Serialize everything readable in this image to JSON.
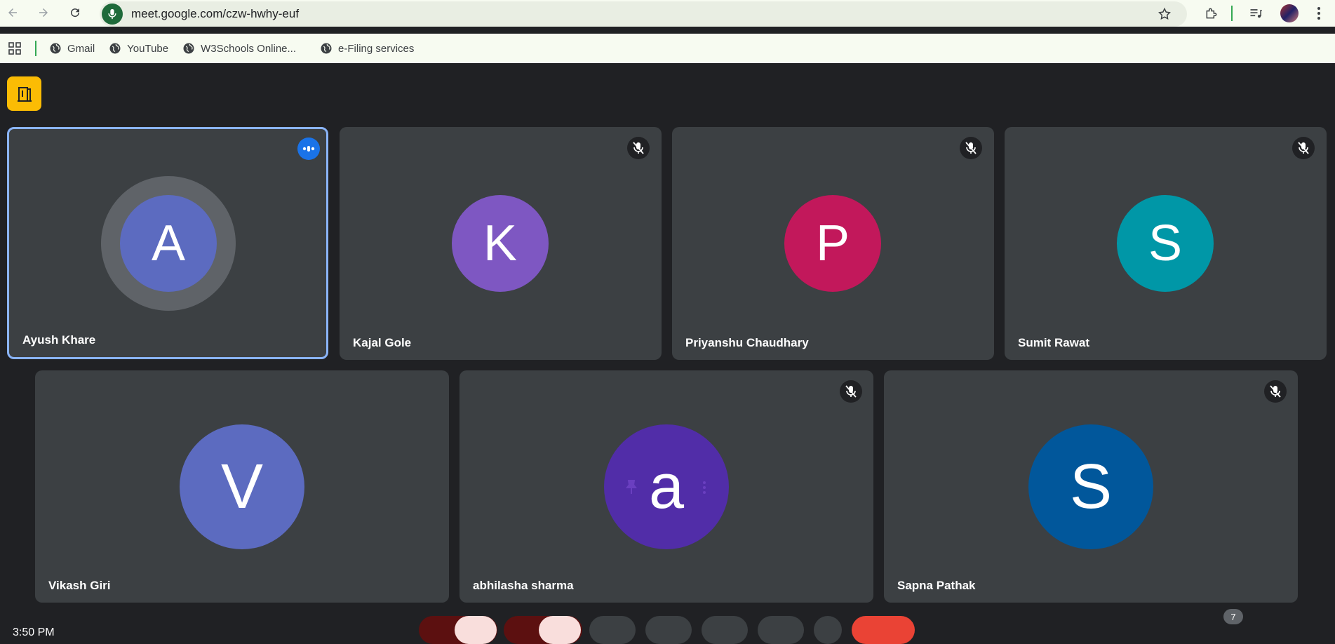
{
  "browser": {
    "url": "meet.google.com/czw-hwhy-euf",
    "bookmarks": [
      "Gmail",
      "YouTube",
      "W3Schools Online...",
      "e-Filing services"
    ]
  },
  "meeting": {
    "participant_count": "7",
    "clock": "3:50 PM",
    "participants": [
      {
        "name": "Ayush Khare",
        "initial": "A",
        "color": "#5c6bc0",
        "muted": false,
        "speaking": true
      },
      {
        "name": "Kajal Gole",
        "initial": "K",
        "color": "#7e57c2",
        "muted": true
      },
      {
        "name": "Priyanshu Chaudhary",
        "initial": "P",
        "color": "#c2185b",
        "muted": true
      },
      {
        "name": "Sumit Rawat",
        "initial": "S",
        "color": "#0097a7",
        "muted": true
      },
      {
        "name": "Vikash Giri",
        "initial": "V",
        "color": "#5c6bc0",
        "muted": false
      },
      {
        "name": "abhilasha sharma",
        "initial": "a",
        "color": "#512da8",
        "muted": true
      },
      {
        "name": "Sapna Pathak",
        "initial": "S",
        "color": "#01579b",
        "muted": true
      }
    ]
  }
}
